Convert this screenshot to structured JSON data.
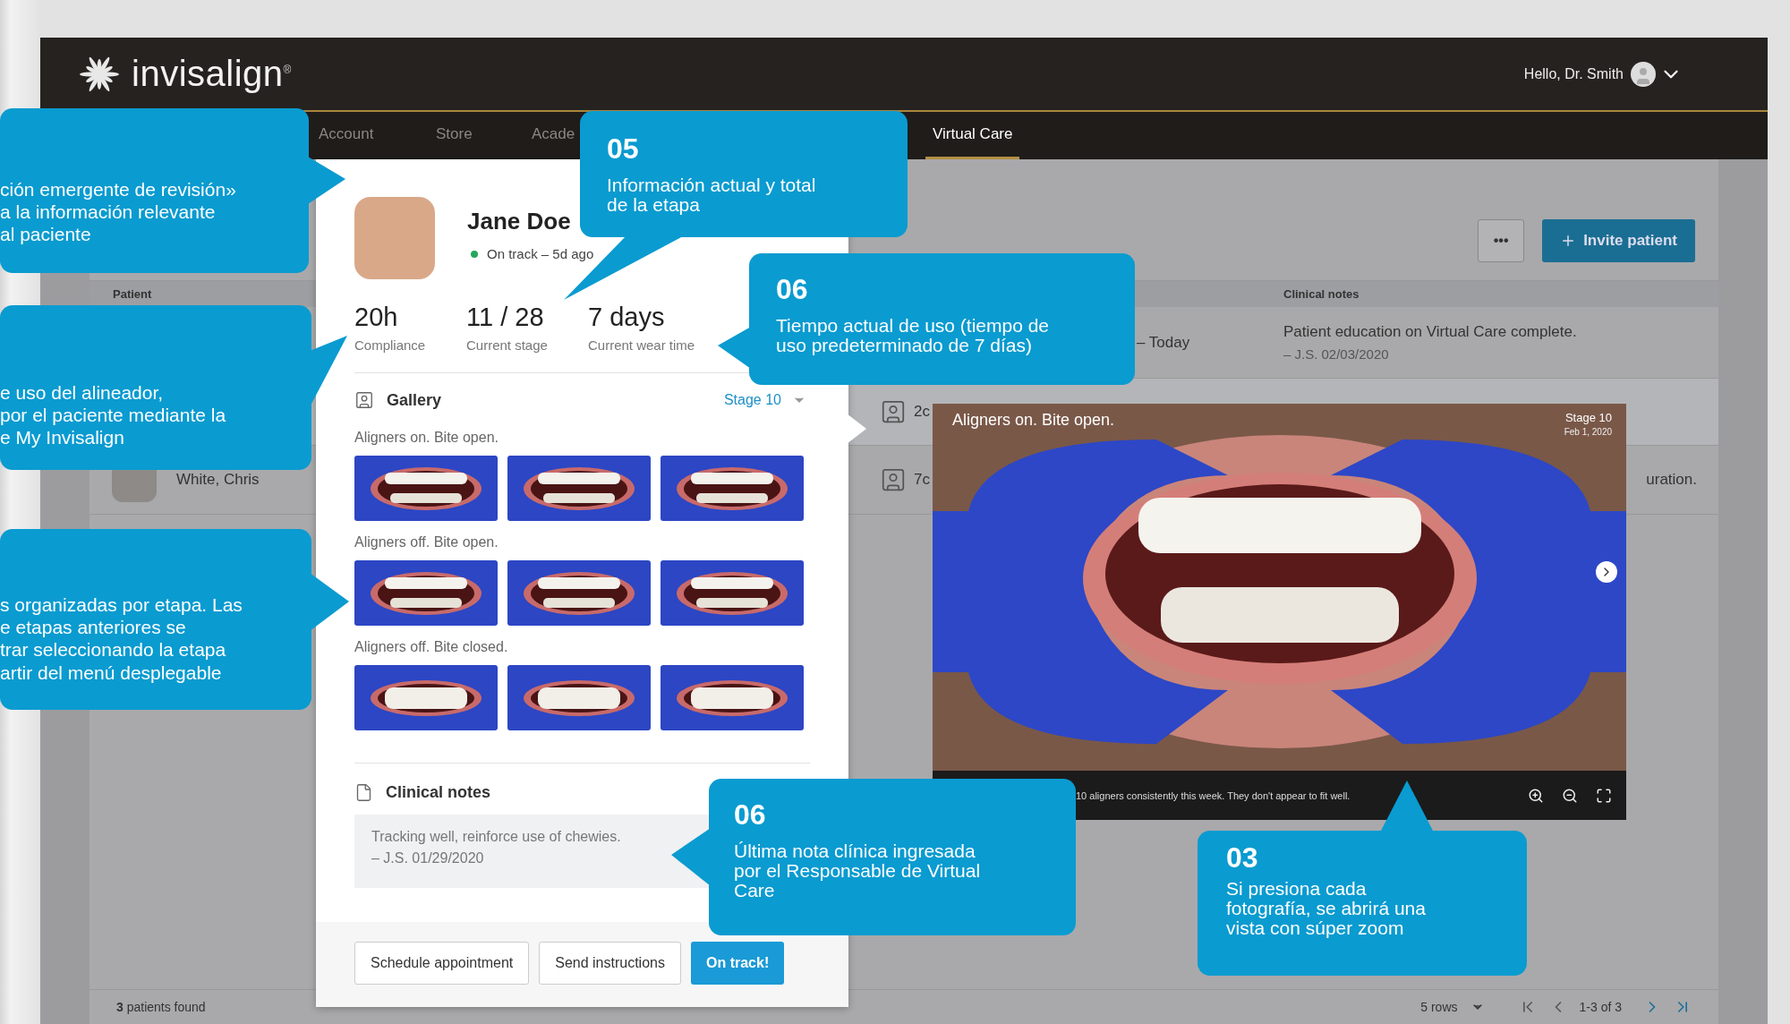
{
  "header": {
    "logo": "invisalign$^{®}$",
    "greeting": "Hello, Dr. Smith"
  },
  "nav_tabs": [
    {
      "label": "Account",
      "selected": false
    },
    {
      "label": "Store",
      "selected": false
    },
    {
      "label": "Acade",
      "selected": false
    },
    {
      "label": "Virtual Care",
      "selected": true
    }
  ],
  "toolbar": {
    "more_button": "•••",
    "invite_button": "Invite patient"
  },
  "table": {
    "columns": [
      "Patient",
      "Clinical notes"
    ],
    "rows": [
      {
        "selected": false,
        "date": "– Today",
        "note": "Patient education on Virtual Care complete.",
        "note_author": "– J.S. 02/03/2020"
      },
      {
        "selected": true,
        "gallery": "2c"
      },
      {
        "selected": false,
        "patient": "White, Chris",
        "gallery": "7c",
        "note_tail": "uration."
      }
    ]
  },
  "footer": {
    "count": "**3** patients found",
    "rows_select": "5 rows",
    "range": "1-3 of 3"
  },
  "review_popup": {
    "name": "Jane Doe",
    "status": "On track – 5d ago",
    "stats": [
      {
        "value": "20h",
        "label": "Compliance"
      },
      {
        "value": "11 / 28",
        "label": "Current stage"
      },
      {
        "value": "7 days",
        "label": "Current wear time"
      }
    ],
    "gallery": {
      "title": "Gallery",
      "stage_select": "Stage 10",
      "sections": [
        {
          "label": "Aligners on. Bite open.",
          "photos": [
            {
              "kind": "open"
            },
            {
              "kind": "open"
            },
            {
              "kind": "open"
            }
          ]
        },
        {
          "label": "Aligners off. Bite open.",
          "photos": [
            {
              "kind": "open"
            },
            {
              "kind": "open"
            },
            {
              "kind": "open"
            }
          ]
        },
        {
          "label": "Aligners off. Bite closed.",
          "photos": [
            {
              "kind": "closed"
            },
            {
              "kind": "closed"
            },
            {
              "kind": "closed"
            }
          ]
        }
      ]
    },
    "clinical_notes": {
      "title": "Clinical notes",
      "note": "Tracking well, reinforce use of chewies.",
      "author": "– J.S. 01/29/2020"
    },
    "buttons": [
      {
        "label": "Schedule appointment",
        "kind": "secondary"
      },
      {
        "label": "Send instructions",
        "kind": "secondary"
      },
      {
        "label": "On track!",
        "kind": "primary"
      }
    ]
  },
  "photo_viewer": {
    "caption": "Aligners on. Bite open.",
    "stage": "Stage 10",
    "date": "Feb 1, 2020",
    "comment": "10 aligners consistently this week. They don't appear to fit well."
  },
  "callouts": [
    {
      "lines": [
        "ción emergente de revisión»",
        "a la información relevante",
        "al paciente"
      ]
    },
    {
      "lines": [
        "e uso del alineador,",
        "por el paciente mediante la",
        "e My Invisalign"
      ]
    },
    {
      "lines": [
        "s organizadas por etapa. Las",
        "e etapas anteriores se",
        "trar seleccionando la etapa",
        "artir del menú desplegable"
      ]
    },
    {
      "number": "05",
      "text": "Información actual y total de la etapa"
    },
    {
      "number": "06",
      "text": "Tiempo actual de uso (tiempo de uso predeterminado de 7 días)"
    },
    {
      "number": "06",
      "text": "Última nota clínica ingresada por el Responsable de Virtual Care"
    },
    {
      "number": "03",
      "text": "Si presiona cada fotografía, se abrirá una vista con súper zoom"
    }
  ]
}
